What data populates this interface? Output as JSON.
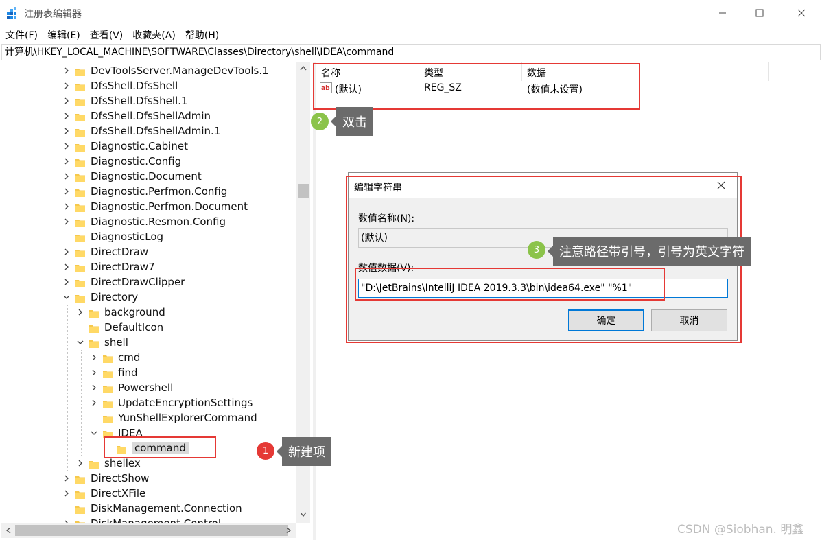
{
  "window": {
    "title": "注册表编辑器",
    "minimize_icon": "minimize-icon",
    "maximize_icon": "maximize-icon",
    "close_icon": "close-icon"
  },
  "menu": [
    "文件(F)",
    "编辑(E)",
    "查看(V)",
    "收藏夹(A)",
    "帮助(H)"
  ],
  "address": "计算机\\HKEY_LOCAL_MACHINE\\SOFTWARE\\Classes\\Directory\\shell\\IDEA\\command",
  "tree": [
    {
      "label": "DevToolsServer.ManageDevTools.1",
      "expander": "right"
    },
    {
      "label": "DfsShell.DfsShell",
      "expander": "right"
    },
    {
      "label": "DfsShell.DfsShell.1",
      "expander": "right"
    },
    {
      "label": "DfsShell.DfsShellAdmin",
      "expander": "right"
    },
    {
      "label": "DfsShell.DfsShellAdmin.1",
      "expander": "right"
    },
    {
      "label": "Diagnostic.Cabinet",
      "expander": "right"
    },
    {
      "label": "Diagnostic.Config",
      "expander": "right"
    },
    {
      "label": "Diagnostic.Document",
      "expander": "right"
    },
    {
      "label": "Diagnostic.Perfmon.Config",
      "expander": "right"
    },
    {
      "label": "Diagnostic.Perfmon.Document",
      "expander": "right"
    },
    {
      "label": "Diagnostic.Resmon.Config",
      "expander": "right"
    },
    {
      "label": "DiagnosticLog",
      "expander": "none"
    },
    {
      "label": "DirectDraw",
      "expander": "right"
    },
    {
      "label": "DirectDraw7",
      "expander": "right"
    },
    {
      "label": "DirectDrawClipper",
      "expander": "right"
    },
    {
      "label": "Directory",
      "expander": "down"
    },
    {
      "label": "background",
      "expander": "right"
    },
    {
      "label": "DefaultIcon",
      "expander": "none"
    },
    {
      "label": "shell",
      "expander": "down"
    },
    {
      "label": "cmd",
      "expander": "right"
    },
    {
      "label": "find",
      "expander": "right"
    },
    {
      "label": "Powershell",
      "expander": "right"
    },
    {
      "label": "UpdateEncryptionSettings",
      "expander": "right"
    },
    {
      "label": "YunShellExplorerCommand",
      "expander": "none"
    },
    {
      "label": "IDEA",
      "expander": "down"
    },
    {
      "label": "command",
      "expander": "none",
      "selected": true
    },
    {
      "label": "shellex",
      "expander": "right"
    },
    {
      "label": "DirectShow",
      "expander": "right"
    },
    {
      "label": "DirectXFile",
      "expander": "right"
    },
    {
      "label": "DiskManagement.Connection",
      "expander": "none"
    },
    {
      "label": "DiskManagement.Control",
      "expander": "right"
    }
  ],
  "list": {
    "columns": [
      "名称",
      "类型",
      "数据"
    ],
    "rows": [
      {
        "icon": "ab-string-icon",
        "name": "(默认)",
        "type": "REG_SZ",
        "data": "(数值未设置)"
      }
    ]
  },
  "dialog": {
    "title": "编辑字符串",
    "name_label": "数值名称(N):",
    "name_value": "(默认)",
    "data_label": "数值数据(V):",
    "data_value": "\"D:\\JetBrains\\IntelliJ IDEA 2019.3.3\\bin\\idea64.exe\" \"%1\"",
    "ok_label": "确定",
    "cancel_label": "取消"
  },
  "annotations": [
    {
      "number": "1",
      "text": "新建项",
      "color": "#e53935"
    },
    {
      "number": "2",
      "text": "双击",
      "color": "#8bc34a"
    },
    {
      "number": "3",
      "text": "注意路径带引号，引号为英文字符",
      "color": "#8bc34a"
    }
  ],
  "watermark": "CSDN @Siobhan. 明鑫"
}
